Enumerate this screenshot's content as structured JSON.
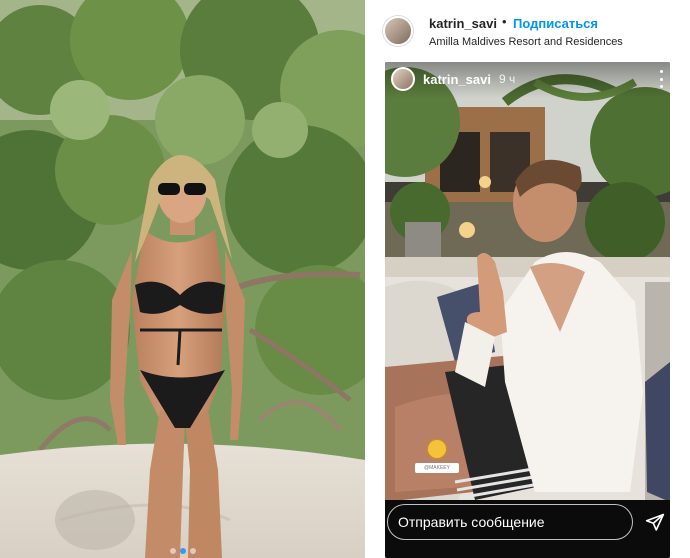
{
  "post": {
    "carousel": {
      "slide_count": 3,
      "active_index": 1
    }
  },
  "header": {
    "username": "katrin_savi",
    "separator": "•",
    "follow_label": "Подписаться",
    "location": "Amilla Maldives Resort and Residences"
  },
  "story": {
    "username": "katrin_savi",
    "time_ago": "9 ч",
    "emoji": "grinning-sweat-emoji",
    "mention": "@ΜΑΚΕΕΥ",
    "reply_placeholder": "Отправить сообщение",
    "icons": {
      "more": "more-vertical-icon",
      "send": "send-icon"
    }
  },
  "colors": {
    "link_blue": "#0095f6",
    "active_dot": "#3897f0",
    "text": "#262626"
  }
}
